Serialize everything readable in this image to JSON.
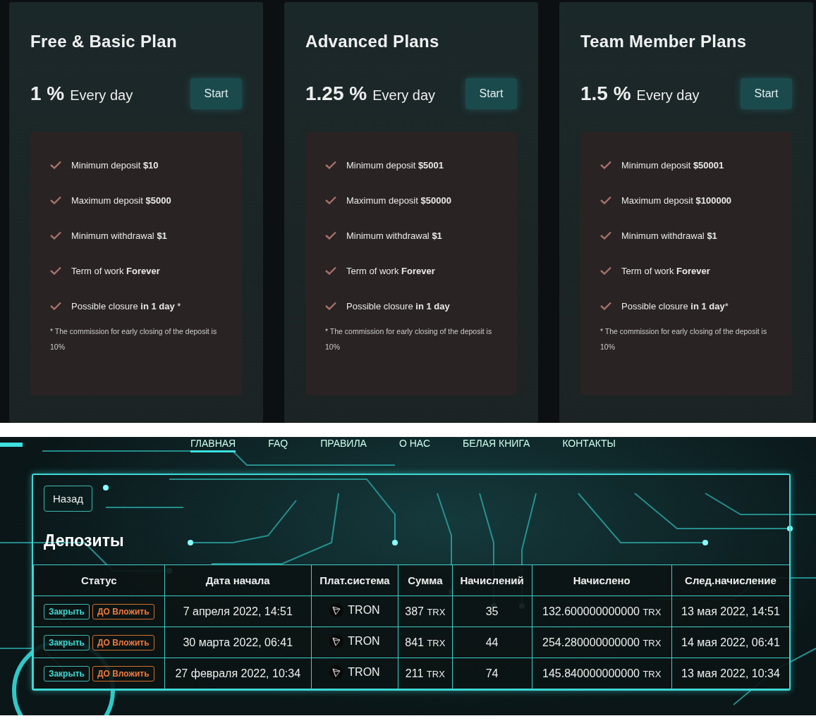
{
  "plans": [
    {
      "title": "Free & Basic Plan",
      "rate": "1 %",
      "rate_label": "Every day",
      "button": "Start",
      "features": [
        "Minimum deposit **$10**",
        "Maximum deposit **$5000**",
        "Minimum withdrawal **$1**",
        "Term of work **Forever**",
        "Possible closure **in 1 day** *"
      ],
      "note": "* The commission for early closing of the deposit is 10%"
    },
    {
      "title": "Advanced Plans",
      "rate": "1.25 %",
      "rate_label": "Every day",
      "button": "Start",
      "features": [
        "Minimum deposit **$5001**",
        "Maximum deposit **$50000**",
        "Minimum withdrawal **$1**",
        "Term of work **Forever**",
        "Possible closure **in 1 day**"
      ],
      "note": "* The commission for early closing of the deposit is 10%"
    },
    {
      "title": "Team Member Plans",
      "rate": "1.5 %",
      "rate_label": "Every day",
      "button": "Start",
      "features": [
        "Minimum deposit **$50001**",
        "Maximum deposit **$100000**",
        "Minimum withdrawal **$1**",
        "Term of work **Forever**",
        "Possible closure **in 1 day***"
      ],
      "note": "* The commission for early closing of the deposit is 10%"
    }
  ],
  "nav": [
    {
      "label": "ГЛАВНАЯ",
      "selected": true
    },
    {
      "label": "FAQ",
      "selected": false
    },
    {
      "label": "ПРАВИЛА",
      "selected": false
    },
    {
      "label": "О НАС",
      "selected": false
    },
    {
      "label": "БЕЛАЯ КНИГА",
      "selected": false
    },
    {
      "label": "КОНТАКТЫ",
      "selected": false
    }
  ],
  "back_button": "Назад",
  "heading": "Депозиты",
  "table": {
    "columns": [
      "Статус",
      "Дата начала",
      "Плат.система",
      "Сумма",
      "Начислений",
      "Начислено",
      "След.начисление"
    ],
    "rows": [
      {
        "actions": [
          "Закрыть",
          "ДО Вложить"
        ],
        "start": "7 апреля 2022, 14:51",
        "system": "TRON",
        "amount": "387",
        "amount_unit": "TRX",
        "count": "35",
        "accrued": "132.600000000000",
        "accrued_unit": "TRX",
        "next": "13 мая 2022, 14:51"
      },
      {
        "actions": [
          "Закрыть",
          "ДО Вложить"
        ],
        "start": "30 марта 2022, 06:41",
        "system": "TRON",
        "amount": "841",
        "amount_unit": "TRX",
        "count": "44",
        "accrued": "254.280000000000",
        "accrued_unit": "TRX",
        "next": "14 мая 2022, 06:41"
      },
      {
        "actions": [
          "Закрыть",
          "ДО Вложить"
        ],
        "start": "27 февраля 2022, 10:34",
        "system": "TRON",
        "amount": "211",
        "amount_unit": "TRX",
        "count": "74",
        "accrued": "145.840000000000",
        "accrued_unit": "TRX",
        "next": "13 мая 2022, 10:34"
      }
    ]
  }
}
